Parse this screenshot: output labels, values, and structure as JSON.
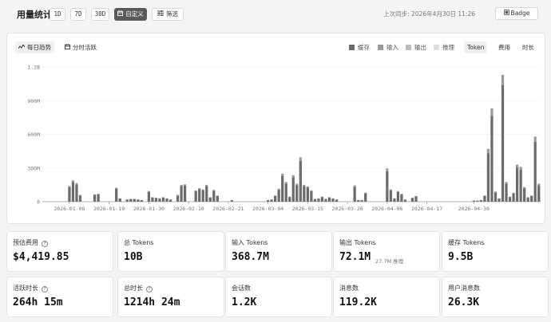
{
  "header": {
    "title": "用量统计",
    "ranges": [
      "1D",
      "7D",
      "30D"
    ],
    "custom_label": "自定义",
    "filter_label": "筛选",
    "sync_text": "上次同步: 2026年4月30日 11:26",
    "badge_label": "Badge"
  },
  "chart_card": {
    "view_tabs": [
      "每日趋势",
      "分时活跃"
    ],
    "legend": [
      {
        "name": "缓存",
        "color": "#6b6b6b"
      },
      {
        "name": "输入",
        "color": "#9a9a9a"
      },
      {
        "name": "输出",
        "color": "#bdbdbd"
      },
      {
        "name": "推理",
        "color": "#dcdcdc"
      }
    ],
    "metric_tabs": [
      "Token",
      "费用",
      "时长"
    ]
  },
  "chart_data": {
    "type": "bar",
    "ylim": [
      0,
      1200000000
    ],
    "y_ticks": [
      "0",
      "300M",
      "600M",
      "900M",
      "1.2B"
    ],
    "x_ticks": [
      "2026-01-08",
      "2026-01-19",
      "2026-01-30",
      "2026-02-10",
      "2026-02-21",
      "2026-03-04",
      "2026-03-15",
      "2026-03-26",
      "2026-04-06",
      "2026-04-17",
      "2026-04-30"
    ],
    "x_start": "2026-01-01",
    "x_end": "2026-04-30",
    "grid": true,
    "series": [
      {
        "name": "缓存",
        "color": "#6b6b6b"
      },
      {
        "name": "输入",
        "color": "#9a9a9a"
      }
    ],
    "values": [
      0,
      0,
      0,
      0,
      0,
      0,
      0,
      140000000,
      190000000,
      165000000,
      60000000,
      0,
      0,
      0,
      65000000,
      70000000,
      0,
      0,
      0,
      0,
      125000000,
      30000000,
      0,
      20000000,
      25000000,
      25000000,
      20000000,
      15000000,
      0,
      95000000,
      40000000,
      35000000,
      30000000,
      40000000,
      30000000,
      20000000,
      0,
      60000000,
      150000000,
      155000000,
      0,
      0,
      100000000,
      120000000,
      110000000,
      150000000,
      40000000,
      105000000,
      55000000,
      0,
      0,
      0,
      15000000,
      0,
      0,
      0,
      0,
      0,
      0,
      0,
      0,
      0,
      15000000,
      20000000,
      55000000,
      115000000,
      250000000,
      175000000,
      45000000,
      235000000,
      160000000,
      395000000,
      150000000,
      135000000,
      100000000,
      25000000,
      30000000,
      45000000,
      25000000,
      40000000,
      30000000,
      20000000,
      0,
      0,
      0,
      0,
      145000000,
      15000000,
      15000000,
      80000000,
      0,
      0,
      0,
      0,
      0,
      295000000,
      110000000,
      30000000,
      95000000,
      70000000,
      20000000,
      0,
      35000000,
      50000000,
      0,
      0,
      0,
      0,
      0,
      0,
      0,
      0,
      0,
      0,
      0,
      0,
      0,
      0,
      0,
      10000000,
      10000000,
      15000000,
      55000000,
      470000000,
      830000000,
      90000000,
      30000000,
      1130000000,
      175000000,
      45000000,
      80000000,
      330000000,
      310000000,
      130000000,
      40000000,
      55000000,
      580000000,
      160000000
    ],
    "input_share": 0.08
  },
  "stats": [
    {
      "label": "预估费用",
      "info": true,
      "value": "$4,419.85"
    },
    {
      "label": "总 Tokens",
      "value": "10B"
    },
    {
      "label": "输入 Tokens",
      "value": "368.7M"
    },
    {
      "label": "输出 Tokens",
      "value": "72.1M",
      "sub": "27.7M 推理"
    },
    {
      "label": "缓存 Tokens",
      "value": "9.5B"
    },
    {
      "label": "活跃时长",
      "info": true,
      "value": "264h 15m"
    },
    {
      "label": "总时长",
      "info": true,
      "value": "1214h 24m"
    },
    {
      "label": "会话数",
      "value": "1.2K"
    },
    {
      "label": "消息数",
      "value": "119.2K"
    },
    {
      "label": "用户消息数",
      "value": "26.3K"
    }
  ]
}
